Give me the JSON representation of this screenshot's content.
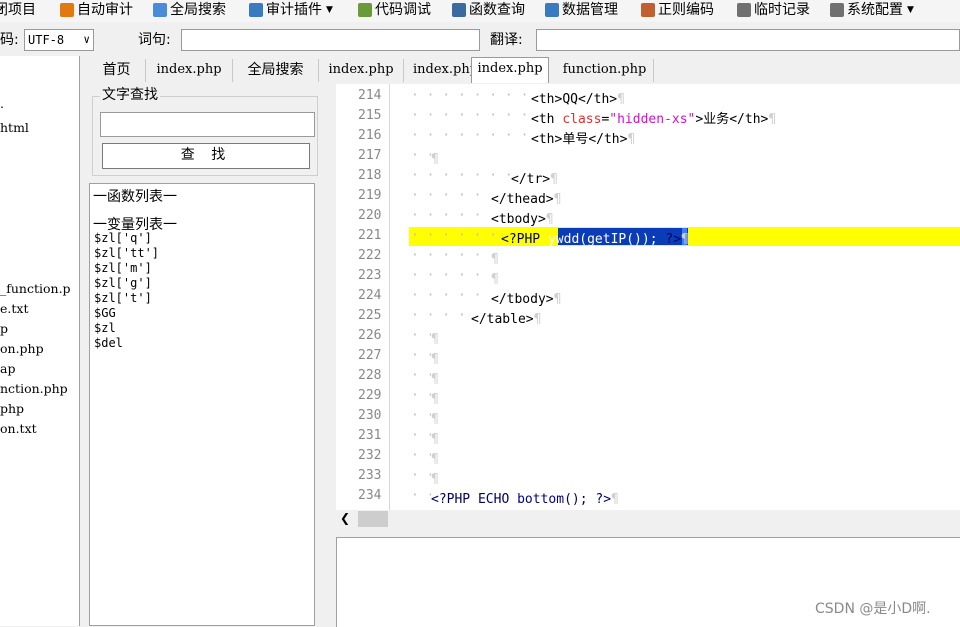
{
  "toolbar": {
    "items": [
      {
        "label": "闭项目",
        "icon": "close-project-icon",
        "color": "#7a5a2a"
      },
      {
        "label": "自动审计",
        "icon": "audit-icon",
        "color": "#e07a10"
      },
      {
        "label": "全局搜索",
        "icon": "search-bubble-icon",
        "color": "#4a8cd8"
      },
      {
        "label": "审计插件",
        "icon": "plugin-icon",
        "color": "#3a7ac0",
        "dropdown": true
      },
      {
        "label": "代码调试",
        "icon": "debug-icon",
        "color": "#6a9a3a"
      },
      {
        "label": "函数查询",
        "icon": "magnifier-icon",
        "color": "#3a6aa0"
      },
      {
        "label": "数据管理",
        "icon": "data-icon",
        "color": "#3a7ac0"
      },
      {
        "label": "正则编码",
        "icon": "regex-icon",
        "color": "#c06030"
      },
      {
        "label": "临时记录",
        "icon": "note-icon",
        "color": "#707070"
      },
      {
        "label": "系统配置",
        "icon": "gear-icon",
        "color": "#707070",
        "dropdown": true
      }
    ]
  },
  "row2": {
    "encoding_label": "码:",
    "encoding_value": "UTF-8",
    "word_label": "词句:",
    "word_value": "",
    "translate_label": "翻译:",
    "translate_value": ""
  },
  "tree": {
    "items": [
      ".",
      "html",
      "",
      "",
      "",
      "",
      "",
      "",
      "_function.p",
      "e.txt",
      "p",
      "on.php",
      "ap",
      "nction.php",
      "php",
      "on.txt"
    ]
  },
  "search": {
    "legend": "文字查找",
    "input_value": "",
    "button_label": "查 找"
  },
  "lists": {
    "functions_header": "一函数列表一",
    "variables_header": "一变量列表一",
    "variables": [
      "$zl['q']",
      "$zl['tt']",
      "$zl['m']",
      "$zl['g']",
      "$zl['t']",
      "$GG",
      "$zl",
      "$del"
    ]
  },
  "tabs": [
    {
      "label": "首页",
      "active": false
    },
    {
      "label": "index.php",
      "active": false
    },
    {
      "label": "全局搜索",
      "active": false
    },
    {
      "label": "index.php",
      "active": false
    },
    {
      "label": "index.php",
      "active": false
    },
    {
      "label": "index.php",
      "active": true
    },
    {
      "label": "function.php",
      "active": false
    }
  ],
  "editor": {
    "highlight_color": "#ffff00",
    "line_numbers": [
      "214",
      "215",
      "216",
      "217",
      "218",
      "219",
      "220",
      "221",
      "222",
      "223",
      "224",
      "225",
      "226",
      "227",
      "228",
      "229",
      "230",
      "231",
      "232",
      "233",
      "234"
    ],
    "lines": [
      {
        "indent": 12,
        "parts": [
          [
            "tag",
            "<th>"
          ],
          [
            "text",
            "QQ"
          ],
          [
            "tag",
            "</th>"
          ]
        ]
      },
      {
        "indent": 12,
        "parts": [
          [
            "tag",
            "<th "
          ],
          [
            "attr",
            "class"
          ],
          [
            "tag",
            "="
          ],
          [
            "str",
            "\"hidden-xs\""
          ],
          [
            "tag",
            ">"
          ],
          [
            "text",
            "业务"
          ],
          [
            "tag",
            "</th>"
          ]
        ]
      },
      {
        "indent": 12,
        "parts": [
          [
            "tag",
            "<th>"
          ],
          [
            "text",
            "单号"
          ],
          [
            "tag",
            "</th>"
          ]
        ]
      },
      {
        "indent": 2,
        "parts": []
      },
      {
        "indent": 10,
        "parts": [
          [
            "tag",
            "</tr>"
          ]
        ]
      },
      {
        "indent": 8,
        "parts": [
          [
            "tag",
            "</thead>"
          ]
        ]
      },
      {
        "indent": 8,
        "parts": [
          [
            "tag",
            "<tbody>"
          ]
        ]
      },
      {
        "indent": 9,
        "parts": [
          [
            "kw",
            "<?PHP "
          ],
          [
            "fn",
            "ywdd(getIP());"
          ],
          [
            "kw",
            " ?>"
          ]
        ],
        "highlight": true
      },
      {
        "indent": 8,
        "parts": []
      },
      {
        "indent": 8,
        "parts": []
      },
      {
        "indent": 8,
        "parts": [
          [
            "tag",
            "</tbody>"
          ]
        ]
      },
      {
        "indent": 6,
        "parts": [
          [
            "tag",
            "</table>"
          ]
        ]
      },
      {
        "indent": 2,
        "parts": []
      },
      {
        "indent": 2,
        "parts": []
      },
      {
        "indent": 2,
        "parts": []
      },
      {
        "indent": 2,
        "parts": []
      },
      {
        "indent": 2,
        "parts": []
      },
      {
        "indent": 2,
        "parts": []
      },
      {
        "indent": 2,
        "parts": []
      },
      {
        "indent": 2,
        "parts": []
      },
      {
        "indent": 2,
        "parts": [
          [
            "kw",
            "<?PHP ECHO "
          ],
          [
            "fn",
            "bottom"
          ],
          [
            "kw",
            "(); ?>"
          ]
        ]
      }
    ]
  },
  "watermark": "CSDN @是小D啊."
}
